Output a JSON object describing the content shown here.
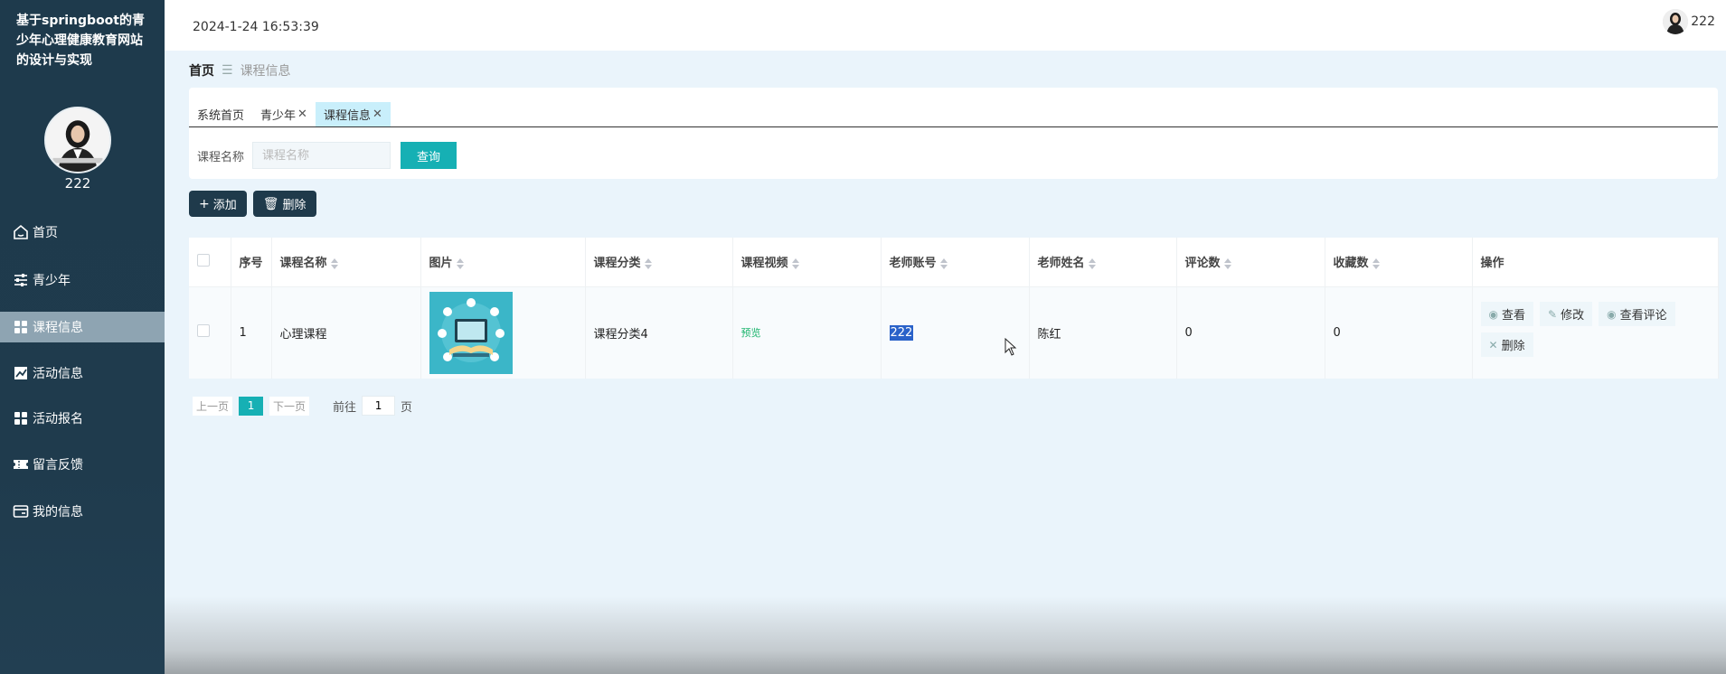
{
  "sidebar": {
    "title": "基于springboot的青少年心理健康教育网站的设计与实现",
    "username": "222",
    "items": [
      {
        "label": "首页",
        "icon": "home-icon"
      },
      {
        "label": "青少年",
        "icon": "sliders-icon"
      },
      {
        "label": "课程信息",
        "icon": "grid-icon",
        "active": true
      },
      {
        "label": "活动信息",
        "icon": "chart-icon"
      },
      {
        "label": "活动报名",
        "icon": "grid-icon"
      },
      {
        "label": "留言反馈",
        "icon": "ticket-icon"
      },
      {
        "label": "我的信息",
        "icon": "card-icon"
      }
    ]
  },
  "header": {
    "datetime": "2024-1-24 16:53:39",
    "username": "222"
  },
  "breadcrumb": {
    "home": "首页",
    "current": "课程信息"
  },
  "tabs": [
    {
      "label": "系统首页",
      "closable": false
    },
    {
      "label": "青少年",
      "closable": true
    },
    {
      "label": "课程信息",
      "closable": true,
      "active": true
    }
  ],
  "search": {
    "label": "课程名称",
    "placeholder": "课程名称",
    "button": "查询"
  },
  "actions": {
    "add": "添加",
    "delete": "删除"
  },
  "table": {
    "columns": [
      "序号",
      "课程名称",
      "图片",
      "课程分类",
      "课程视频",
      "老师账号",
      "老师姓名",
      "评论数",
      "收藏数",
      "操作"
    ],
    "rows": [
      {
        "index": "1",
        "name": "心理课程",
        "category": "课程分类4",
        "video": "预览",
        "teacher_account": "222",
        "teacher_name": "陈红",
        "comments": "0",
        "favorites": "0"
      }
    ],
    "ops": {
      "view": "查看",
      "edit": "修改",
      "view_comments": "查看评论",
      "delete": "删除"
    }
  },
  "pagination": {
    "prev": "上一页",
    "current": "1",
    "next": "下一页",
    "goto_label": "前往",
    "goto_value": "1",
    "unit": "页"
  },
  "colors": {
    "sidebar_bg": "#1e3a4c",
    "accent": "#16b0b4",
    "active_menu": "#8ea4b2"
  }
}
